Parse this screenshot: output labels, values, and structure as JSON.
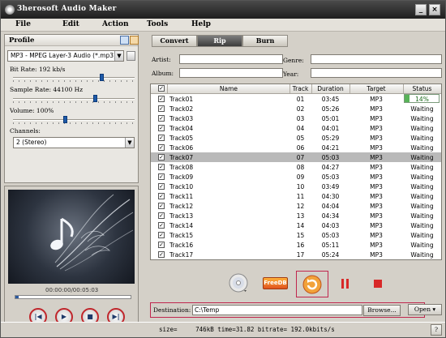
{
  "app": {
    "title": "3herosoft Audio Maker"
  },
  "window": {
    "minimize": "_",
    "close": "×"
  },
  "menu": [
    "File",
    "Edit",
    "Action",
    "Tools",
    "Help"
  ],
  "profile": {
    "title": "Profile",
    "format": "MP3 - MPEG Layer-3 Audio  (*.mp3)",
    "bit_rate_label": "Bit Rate:  192  kb/s",
    "bit_rate_level": 0.74,
    "sample_rate_label": "Sample Rate:  44100  Hz",
    "sample_rate_level": 0.68,
    "volume_label": "Volume:  100%",
    "volume_level": 0.43,
    "channels_label": "Channels:",
    "channels_value": "2 (Stereo)"
  },
  "player": {
    "time": "00:00:00/00:05:03",
    "progress": 0.03
  },
  "tabs": [
    {
      "label": "Convert",
      "active": false
    },
    {
      "label": "Rip",
      "active": true
    },
    {
      "label": "Burn",
      "active": false
    }
  ],
  "meta": {
    "artist_label": "Artist:",
    "album_label": "Album:",
    "genre_label": "Genre:",
    "year_label": "Year:"
  },
  "table": {
    "headers": {
      "check": "✓",
      "name": "Name",
      "track": "Track",
      "duration": "Duration",
      "target": "Target",
      "status": "Status"
    },
    "rows": [
      {
        "name": "Track01",
        "track": "01",
        "duration": "03:45",
        "target": "MP3",
        "status": "14%",
        "progress": 0.14,
        "selected": false
      },
      {
        "name": "Track02",
        "track": "02",
        "duration": "05:26",
        "target": "MP3",
        "status": "Waiting",
        "selected": false
      },
      {
        "name": "Track03",
        "track": "03",
        "duration": "05:01",
        "target": "MP3",
        "status": "Waiting",
        "selected": false
      },
      {
        "name": "Track04",
        "track": "04",
        "duration": "04:01",
        "target": "MP3",
        "status": "Waiting",
        "selected": false
      },
      {
        "name": "Track05",
        "track": "05",
        "duration": "05:29",
        "target": "MP3",
        "status": "Waiting",
        "selected": false
      },
      {
        "name": "Track06",
        "track": "06",
        "duration": "04:21",
        "target": "MP3",
        "status": "Waiting",
        "selected": false
      },
      {
        "name": "Track07",
        "track": "07",
        "duration": "05:03",
        "target": "MP3",
        "status": "Waiting",
        "selected": true
      },
      {
        "name": "Track08",
        "track": "08",
        "duration": "04:27",
        "target": "MP3",
        "status": "Waiting",
        "selected": false
      },
      {
        "name": "Track09",
        "track": "09",
        "duration": "05:03",
        "target": "MP3",
        "status": "Waiting",
        "selected": false
      },
      {
        "name": "Track10",
        "track": "10",
        "duration": "03:49",
        "target": "MP3",
        "status": "Waiting",
        "selected": false
      },
      {
        "name": "Track11",
        "track": "11",
        "duration": "04:30",
        "target": "MP3",
        "status": "Waiting",
        "selected": false
      },
      {
        "name": "Track12",
        "track": "12",
        "duration": "04:04",
        "target": "MP3",
        "status": "Waiting",
        "selected": false
      },
      {
        "name": "Track13",
        "track": "13",
        "duration": "04:34",
        "target": "MP3",
        "status": "Waiting",
        "selected": false
      },
      {
        "name": "Track14",
        "track": "14",
        "duration": "04:03",
        "target": "MP3",
        "status": "Waiting",
        "selected": false
      },
      {
        "name": "Track15",
        "track": "15",
        "duration": "05:03",
        "target": "MP3",
        "status": "Waiting",
        "selected": false
      },
      {
        "name": "Track16",
        "track": "16",
        "duration": "05:11",
        "target": "MP3",
        "status": "Waiting",
        "selected": false
      },
      {
        "name": "Track17",
        "track": "17",
        "duration": "05:24",
        "target": "MP3",
        "status": "Waiting",
        "selected": false
      }
    ]
  },
  "actions": {
    "freedb_label": "FreeDB"
  },
  "destination": {
    "label": "Destination:",
    "value": "C:\\Temp",
    "browse_label": "Browse...",
    "open_label": "Open"
  },
  "status": {
    "text": "size=     746kB time=31.82 bitrate= 192.0kbits/s",
    "help": "?"
  },
  "colors": {
    "accent": "#c0264e",
    "progress": "#58b358",
    "selected_row": "#b9b9b9"
  }
}
